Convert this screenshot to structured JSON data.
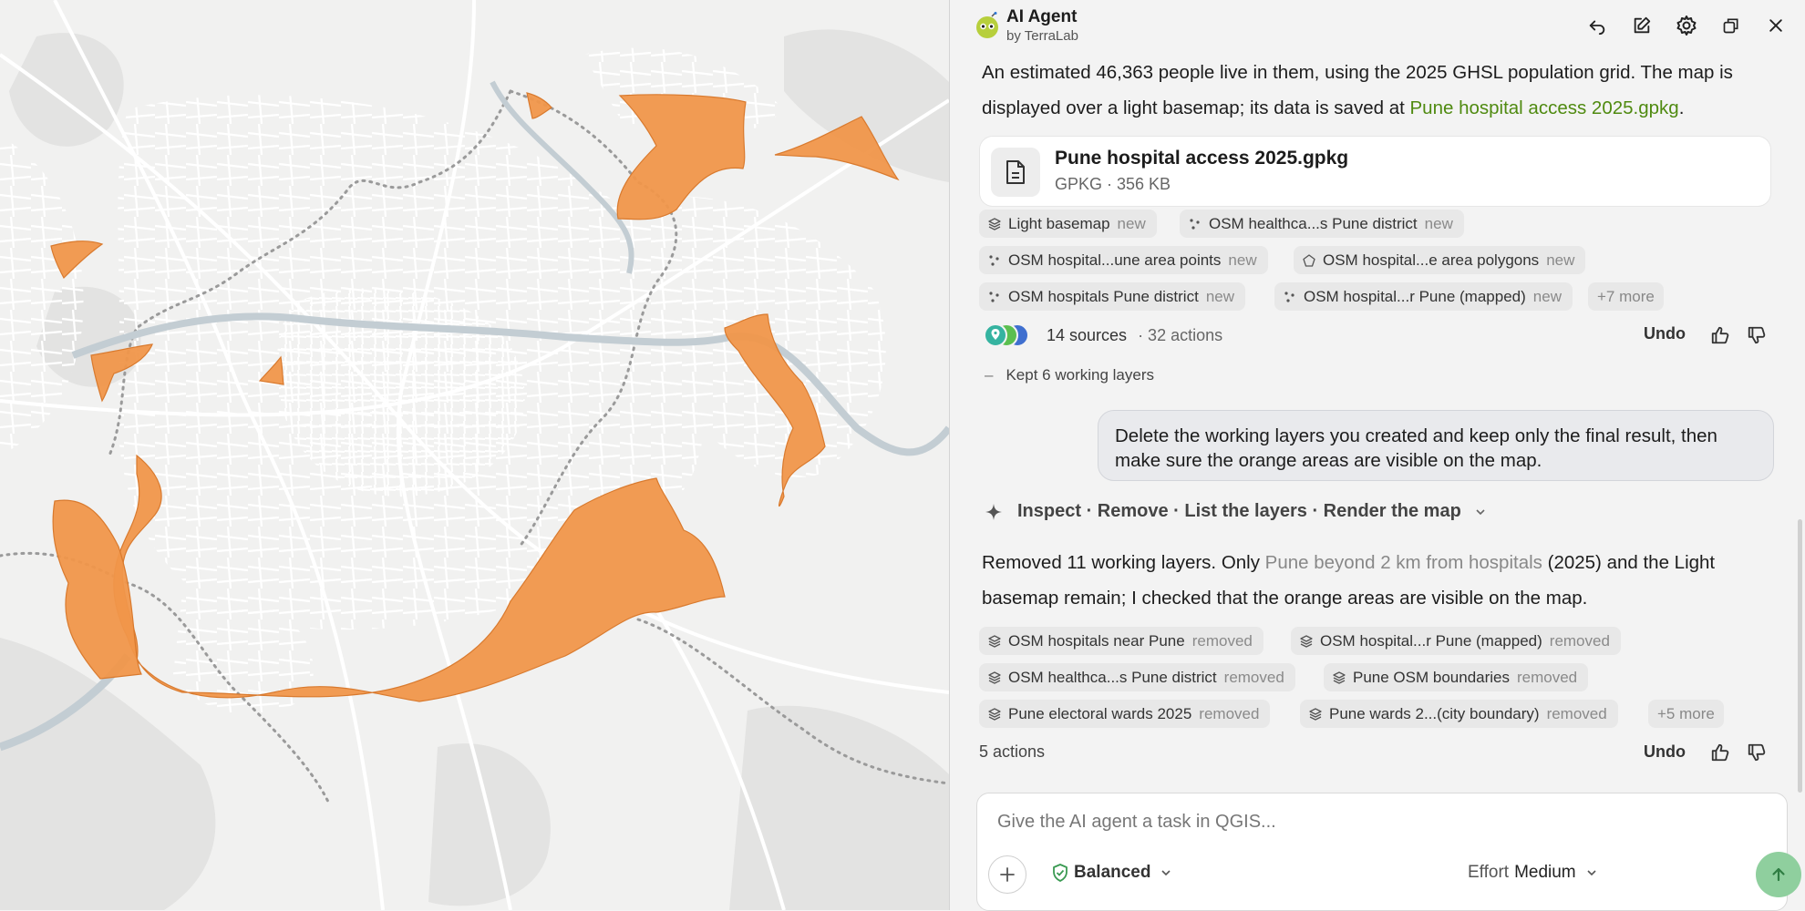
{
  "header": {
    "title": "AI Agent",
    "subtitle": "by TerraLab",
    "icons": [
      "undo-icon",
      "edit-icon",
      "gear-icon",
      "restore-window-icon",
      "close-icon"
    ]
  },
  "chat": {
    "para1_prefix": "An estimated 46,363 people live in them, using the 2025 GHSL population grid. The map is displayed over a light basemap; its data is saved at ",
    "para1_link": "Pune hospital access 2025.gpkg",
    "para1_suffix": ".",
    "file": {
      "name": "Pune hospital access 2025.gpkg",
      "meta": "GPKG · 356 KB"
    },
    "chips1": [
      {
        "label": "Light basemap",
        "tag": "new",
        "icon": "layers-icon"
      },
      {
        "label": "OSM healthca...s Pune district",
        "tag": "new",
        "icon": "points-icon"
      },
      {
        "label": "OSM hospital...une area points",
        "tag": "new",
        "icon": "points-icon"
      },
      {
        "label": "OSM hospital...e area polygons",
        "tag": "new",
        "icon": "polygon-icon"
      },
      {
        "label": "OSM hospitals Pune district",
        "tag": "new",
        "icon": "points-icon"
      },
      {
        "label": "OSM hospital...r Pune (mapped)",
        "tag": "new",
        "icon": "points-icon"
      }
    ],
    "chips1_more": "+7 more",
    "sources": "14 sources",
    "actions1": "· 32 actions",
    "undo_label": "Undo",
    "kept_label": "Kept 6 working layers",
    "user_message": "Delete the working layers you created and keep only the final result, then make sure the orange areas are visible on the map.",
    "steps_label": "Inspect · Remove · List the layers · Render the map",
    "para2_prefix": "Removed 11 working layers. Only ",
    "para2_link": "Pune beyond 2 km from hospitals",
    "para2_suffix": " (2025) and the Light basemap remain; I checked that the orange areas are visible on the map.",
    "chips2": [
      {
        "label": "OSM hospitals near Pune",
        "tag": "removed",
        "icon": "layers-icon"
      },
      {
        "label": "OSM hospital...r Pune (mapped)",
        "tag": "removed",
        "icon": "layers-icon"
      },
      {
        "label": "OSM healthca...s Pune district",
        "tag": "removed",
        "icon": "layers-icon"
      },
      {
        "label": "Pune OSM boundaries",
        "tag": "removed",
        "icon": "layers-icon"
      },
      {
        "label": "Pune electoral wards 2025",
        "tag": "removed",
        "icon": "layers-icon"
      },
      {
        "label": "Pune wards 2...(city boundary)",
        "tag": "removed",
        "icon": "layers-icon"
      }
    ],
    "chips2_more": "+5 more",
    "actions2": "5 actions"
  },
  "input": {
    "placeholder": "Give the AI agent a task in QGIS...",
    "mode": "Balanced",
    "effort_label": "Effort",
    "effort_value": "Medium"
  },
  "map": {
    "fill_color": "#f0964a",
    "basemap_color": "#f1f1f0",
    "river_color": "#c3cdd3"
  }
}
